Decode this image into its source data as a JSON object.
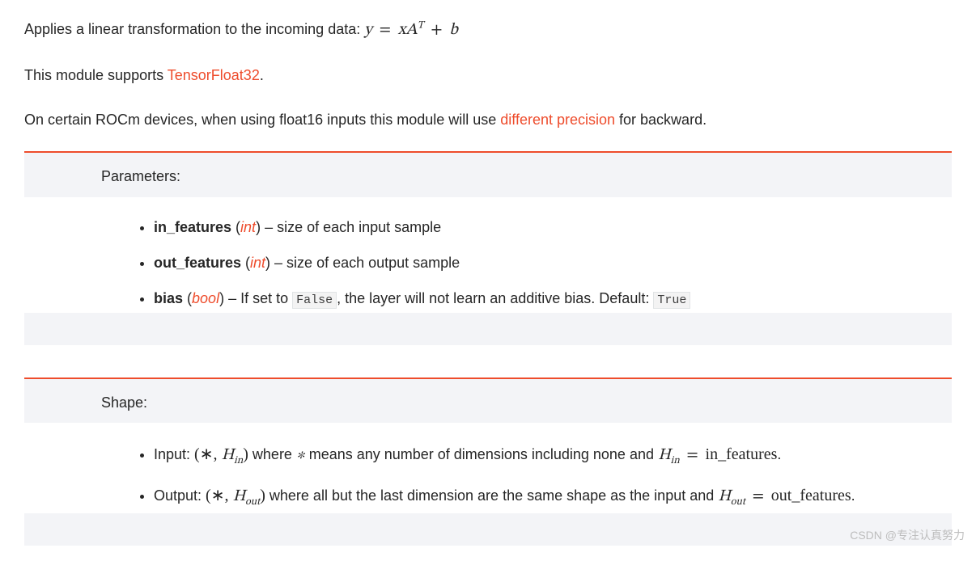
{
  "intro": {
    "sentence_pre": "Applies a linear transformation to the incoming data: ",
    "formula_y": "y",
    "formula_eq": "=",
    "formula_x": "x",
    "formula_A": "A",
    "formula_T": "T",
    "formula_plus": "+",
    "formula_b": "b"
  },
  "support": {
    "pre": "This module supports ",
    "link": "TensorFloat32",
    "post": "."
  },
  "rocm": {
    "pre": "On certain ROCm devices, when using float16 inputs this module will use ",
    "link": "different precision",
    "post": " for backward."
  },
  "params": {
    "heading": "Parameters:",
    "in_features": {
      "name": "in_features",
      "type": "int",
      "desc": " – size of each input sample"
    },
    "out_features": {
      "name": "out_features",
      "type": "int",
      "desc": " – size of each output sample"
    },
    "bias": {
      "name": "bias",
      "type": "bool",
      "desc1": " – If set to ",
      "code1": "False",
      "desc2": ", the layer will not learn an additive bias. Default: ",
      "code2": "True"
    }
  },
  "shape": {
    "heading": "Shape:",
    "input": {
      "label": "Input: ",
      "tuple_open": "(",
      "star": "∗",
      "comma": ", ",
      "H": "H",
      "sub_in": "in",
      "tuple_close": ")",
      "mid1": " where ",
      "star2": "∗",
      "mid2": " means any number of dimensions including none and ",
      "H2": "H",
      "sub_in2": "in",
      "eq": " = ",
      "rhs": "in_features",
      "period": "."
    },
    "output": {
      "label": "Output: ",
      "tuple_open": "(",
      "star": "∗",
      "comma": ", ",
      "H": "H",
      "sub_out": "out",
      "tuple_close": ")",
      "mid": " where all but the last dimension are the same shape as the input and ",
      "H2": "H",
      "sub_out2": "out",
      "eq": " = ",
      "rhs": "out_features",
      "period": "."
    }
  },
  "watermark": "CSDN @专注认真努力"
}
